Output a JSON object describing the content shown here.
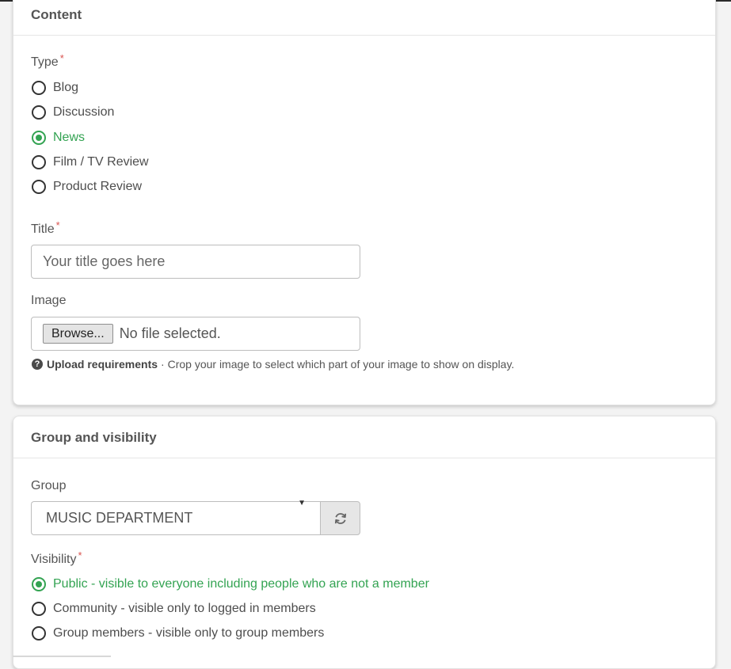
{
  "content_section": {
    "title": "Content",
    "type_field": {
      "label": "Type",
      "required_mark": "*",
      "options": [
        {
          "label": "Blog",
          "checked": false
        },
        {
          "label": "Discussion",
          "checked": false
        },
        {
          "label": "News",
          "checked": true
        },
        {
          "label": "Film / TV Review",
          "checked": false
        },
        {
          "label": "Product Review",
          "checked": false
        }
      ]
    },
    "title_field": {
      "label": "Title",
      "required_mark": "*",
      "placeholder": "Your title goes here",
      "value": ""
    },
    "image_field": {
      "label": "Image",
      "browse_label": "Browse...",
      "status_text": "No file selected.",
      "help_icon": "question-circle-icon",
      "help_icon_glyph": "?",
      "help_title": "Upload requirements",
      "help_text": "· Crop your image to select which part of your image to show on display."
    }
  },
  "group_section": {
    "title": "Group and visibility",
    "group_field": {
      "label": "Group",
      "selected": "MUSIC DEPARTMENT",
      "refresh_icon": "refresh-icon"
    },
    "visibility_field": {
      "label": "Visibility",
      "required_mark": "*",
      "options": [
        {
          "label": "Public - visible to everyone including people who are not a member",
          "checked": true
        },
        {
          "label": "Community - visible only to logged in members",
          "checked": false
        },
        {
          "label": "Group members - visible only to group members",
          "checked": false
        }
      ]
    }
  },
  "colors": {
    "accent_green": "#33a352",
    "required_red": "#d9534f"
  }
}
